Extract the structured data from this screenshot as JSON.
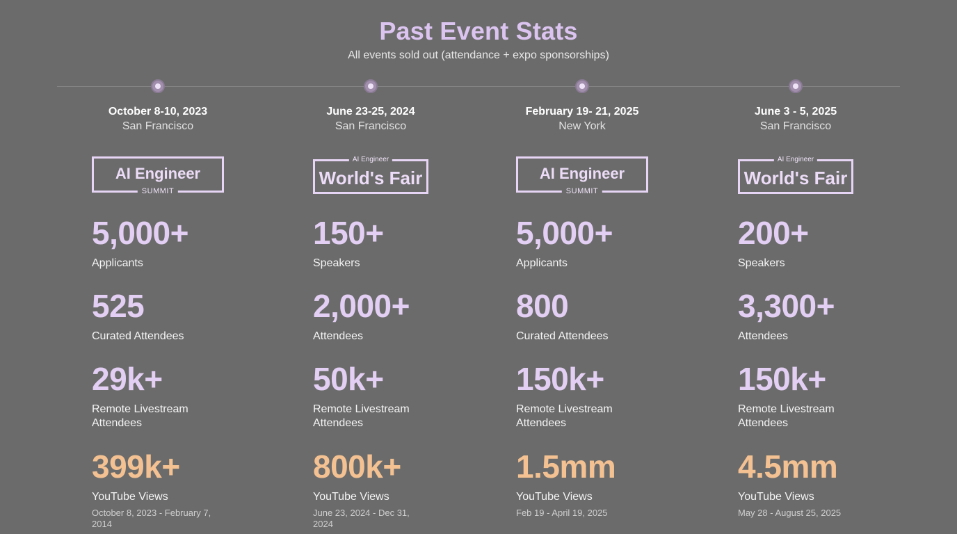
{
  "header": {
    "title": "Past Event Stats",
    "subtitle": "All events sold out (attendance + expo sponsorships)"
  },
  "events": [
    {
      "date": "October 8-10, 2023",
      "city": "San Francisco",
      "logo": {
        "top": "",
        "main": "AI Engineer",
        "sub": "SUMMIT"
      },
      "stats": [
        {
          "value": "5,000+",
          "label": "Applicants"
        },
        {
          "value": "525",
          "label": "Curated Attendees"
        },
        {
          "value": "29k+",
          "label": "Remote Livestream Attendees"
        },
        {
          "value": "399k+",
          "label": "YouTube Views",
          "range": "October 8, 2023 - February 7, 2014"
        }
      ]
    },
    {
      "date": "June 23-25, 2024",
      "city": "San Francisco",
      "logo": {
        "top": "AI Engineer",
        "main": "World's Fair",
        "sub": ""
      },
      "stats": [
        {
          "value": "150+",
          "label": "Speakers"
        },
        {
          "value": "2,000+",
          "label": "Attendees"
        },
        {
          "value": "50k+",
          "label": "Remote Livestream Attendees"
        },
        {
          "value": "800k+",
          "label": "YouTube Views",
          "range": "June 23, 2024 - Dec 31, 2024"
        }
      ]
    },
    {
      "date": "February 19- 21, 2025",
      "city": "New York",
      "logo": {
        "top": "",
        "main": "AI Engineer",
        "sub": "SUMMIT"
      },
      "stats": [
        {
          "value": "5,000+",
          "label": "Applicants"
        },
        {
          "value": "800",
          "label": "Curated Attendees"
        },
        {
          "value": "150k+",
          "label": "Remote Livestream Attendees"
        },
        {
          "value": "1.5mm",
          "label": "YouTube Views",
          "range": "Feb 19 - April 19, 2025"
        }
      ]
    },
    {
      "date": "June 3 - 5, 2025",
      "city": "San Francisco",
      "logo": {
        "top": "AI Engineer",
        "main": "World's Fair",
        "sub": ""
      },
      "stats": [
        {
          "value": "200+",
          "label": "Speakers"
        },
        {
          "value": "3,300+",
          "label": "Attendees"
        },
        {
          "value": "150k+",
          "label": "Remote Livestream Attendees"
        },
        {
          "value": "4.5mm",
          "label": "YouTube Views",
          "range": "May 28 - August 25, 2025"
        }
      ]
    }
  ],
  "colors": {
    "background": "#6b6b6b",
    "title": "#dcc4f0",
    "stat_number": "#e3cff3",
    "views_number": "#f3c192"
  }
}
